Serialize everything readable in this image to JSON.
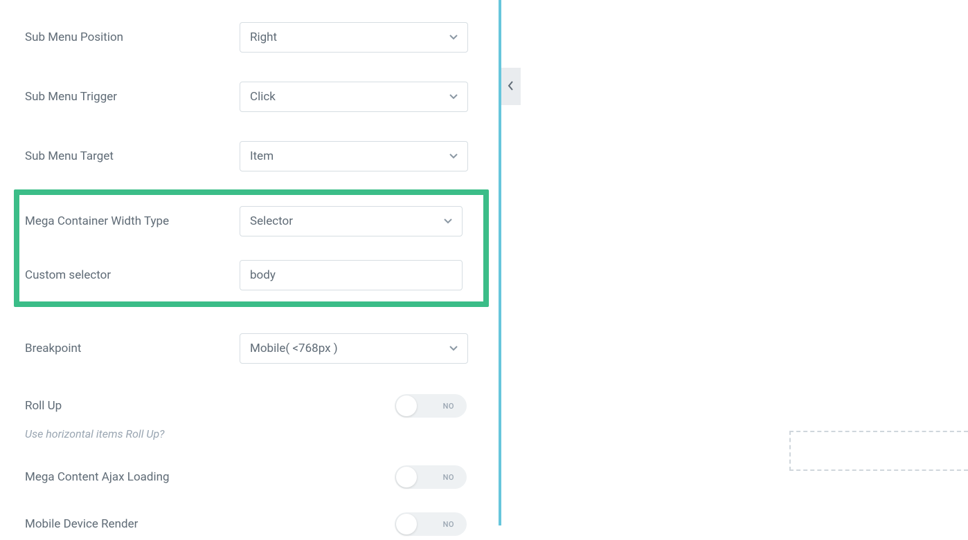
{
  "fields": {
    "sub_menu_position": {
      "label": "Sub Menu Position",
      "value": "Right"
    },
    "sub_menu_trigger": {
      "label": "Sub Menu Trigger",
      "value": "Click"
    },
    "sub_menu_target": {
      "label": "Sub Menu Target",
      "value": "Item"
    },
    "mega_width_type": {
      "label": "Mega Container Width Type",
      "value": "Selector"
    },
    "custom_selector": {
      "label": "Custom selector",
      "value": "body"
    },
    "breakpoint": {
      "label": "Breakpoint",
      "value": "Mobile( <768px )"
    }
  },
  "toggles": {
    "roll_up": {
      "label": "Roll Up",
      "state": "NO",
      "help": "Use horizontal items Roll Up?"
    },
    "ajax_loading": {
      "label": "Mega Content Ajax Loading",
      "state": "NO"
    },
    "mobile_render": {
      "label": "Mobile Device Render",
      "state": "NO"
    }
  }
}
